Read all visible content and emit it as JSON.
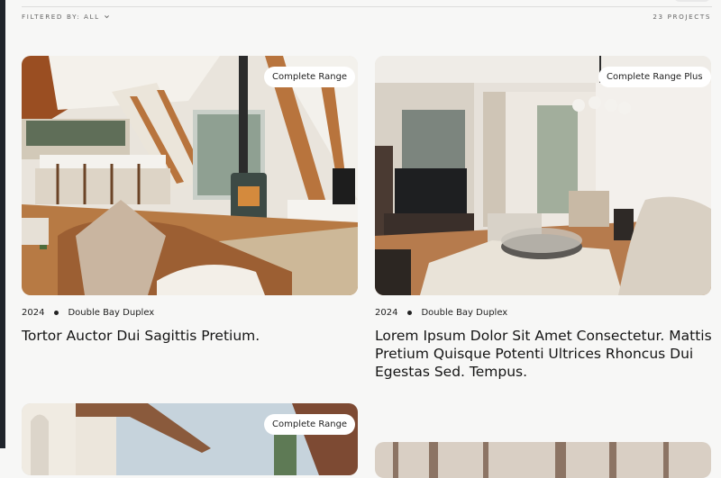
{
  "filter": {
    "label": "FILTERED BY: ALL",
    "icon": "chevron-down-icon"
  },
  "count": {
    "label": "23 PROJECTS"
  },
  "projects": [
    {
      "badge": "Complete Range",
      "year": "2024",
      "location": "Double Bay Duplex",
      "title": "Tortor Auctor Dui Sagittis Pretium."
    },
    {
      "badge": "Complete Range Plus",
      "year": "2024",
      "location": "Double Bay Duplex",
      "title": "Lorem Ipsum Dolor Sit Amet Consectetur. Mattis Pretium Quisque Potenti Ultrices Rhoncus Dui Egestas Sed. Tempus."
    },
    {
      "badge": "Complete Range"
    }
  ]
}
